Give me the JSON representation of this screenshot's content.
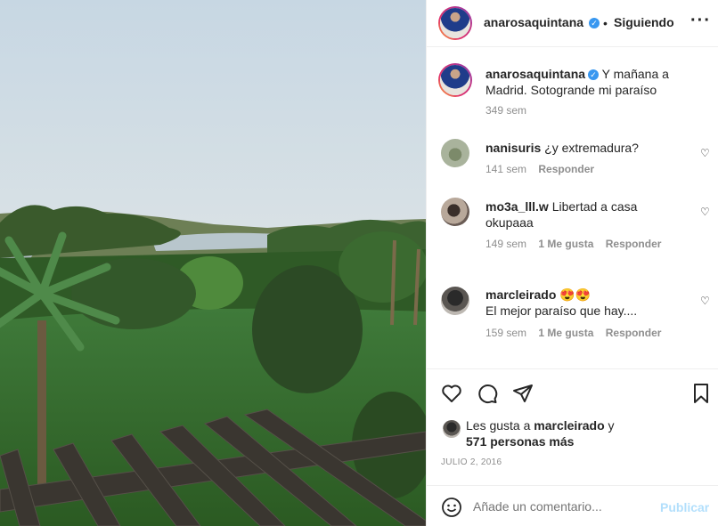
{
  "post_header": {
    "username": "anarosaquintana",
    "separator": "•",
    "follow_status": "Siguiendo",
    "more_icon": "more-icon"
  },
  "caption": {
    "username": "anarosaquintana",
    "text_line1": "Y mañana a",
    "text_line2": "Madrid. Sotogrande mi paraíso",
    "time": "349 sem"
  },
  "comments": [
    {
      "username": "nanisuris",
      "text_line1": "¿y extremadura?",
      "text_line2": "",
      "time": "141 sem",
      "likes": "",
      "reply": "Responder"
    },
    {
      "username": "mo3a_lll.w",
      "text_line1": "Libertad a casa",
      "text_line2": "okupaaa",
      "time": "149 sem",
      "likes": "1 Me gusta",
      "reply": "Responder"
    },
    {
      "username": "marcleirado",
      "text_line1": "😍😍",
      "text_line2": "El mejor paraíso que hay....",
      "time": "159 sem",
      "likes": "1 Me gusta",
      "reply": "Responder"
    }
  ],
  "likes": {
    "prefix": "Les gusta a",
    "user": "marcleirado",
    "connector": "y",
    "others": "571 personas más"
  },
  "date": "JULIO 2, 2016",
  "comment_box": {
    "placeholder": "Añade un comentario...",
    "publish": "Publicar"
  },
  "colors": {
    "accent": "#3897f0",
    "publish_disabled": "#b2dffc",
    "secondary_text": "#8e8e8e"
  }
}
